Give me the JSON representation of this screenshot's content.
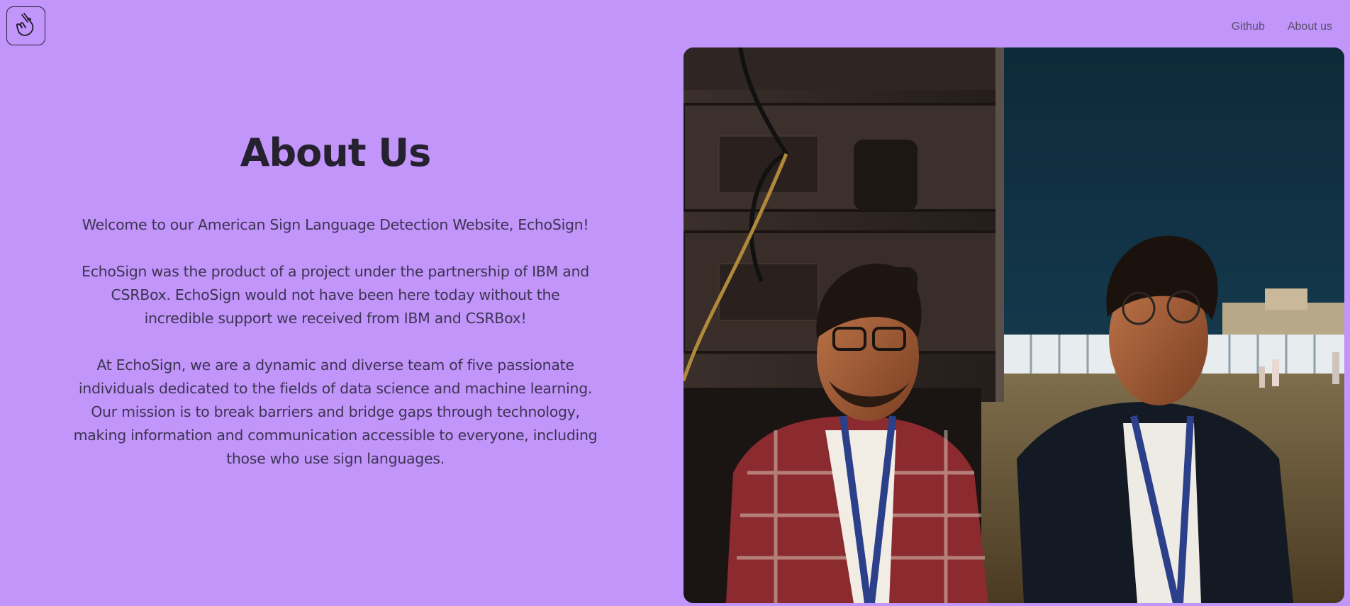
{
  "header": {
    "logo_icon": "hand-snap-icon",
    "nav": [
      {
        "label": "Github"
      },
      {
        "label": "About us"
      }
    ]
  },
  "main": {
    "title": "About Us",
    "paragraphs": [
      "Welcome to our American Sign Language Detection Website, EchoSign!",
      "EchoSign was the product of a project under the partnership of IBM and CSRBox. EchoSign would not have been here today without the incredible support we received from IBM and CSRBox!",
      "At EchoSign, we are a dynamic and diverse team of five passionate individuals dedicated to the fields of data science and machine learning. Our mission is to break barriers and bridge gaps through technology, making information and communication accessible to everyone, including those who use sign languages."
    ]
  },
  "colors": {
    "background": "#c195fa",
    "text": "#3d3452",
    "title": "#26212f"
  }
}
